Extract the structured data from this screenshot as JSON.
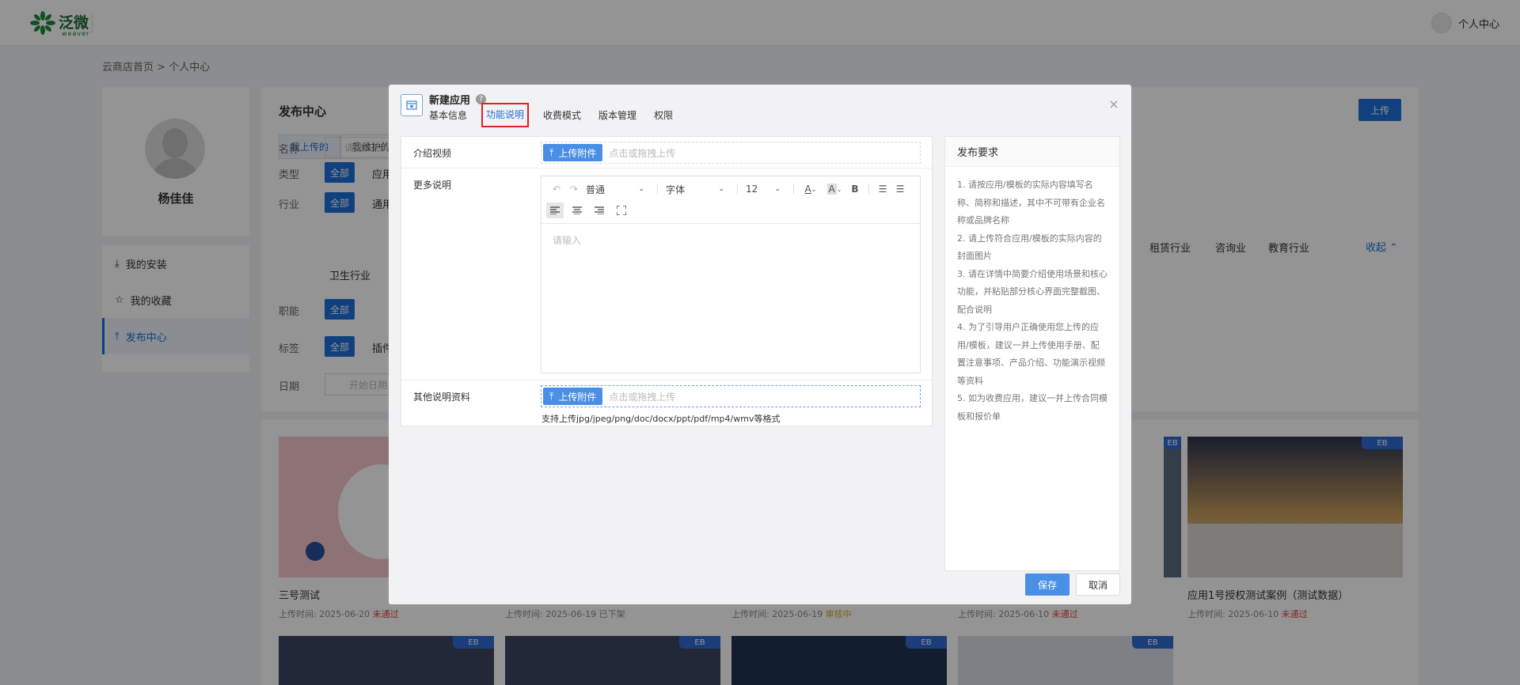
{
  "topbar": {
    "logo_text": "泛微",
    "logo_sub": "weaver",
    "user_label": "个人中心"
  },
  "breadcrumb": {
    "home": "云商店首页",
    "sep": ">",
    "current": "个人中心"
  },
  "profile": {
    "name": "杨佳佳"
  },
  "side_menu": {
    "items": [
      {
        "label": "我的安装"
      },
      {
        "label": "我的收藏"
      },
      {
        "label": "发布中心"
      }
    ]
  },
  "main": {
    "title": "发布中心",
    "upload_label": "上传",
    "tabs": [
      "我上传的",
      "我维护的"
    ],
    "filters": {
      "name_label": "名称",
      "name_placeholder": "请输入应用",
      "type_label": "类型",
      "type_first": "应用",
      "industry_label": "行业",
      "industry_first": "通用",
      "industry_more": [
        "租赁行业",
        "咨询业",
        "教育行业"
      ],
      "industry_row2": "卫生行业",
      "function_label": "职能",
      "tag_label": "标签",
      "tag_first": "插件",
      "date_label": "日期",
      "date_placeholder": "开始日期",
      "all_label": "全部",
      "collapse_label": "收起"
    }
  },
  "cards": [
    {
      "title": "三号测试",
      "date_label": "上传时间:",
      "date": "2025-06-20",
      "status": "未通过"
    },
    {
      "title": "",
      "date_label": "上传时间:",
      "date": "2025-06-19",
      "status": "已下架"
    },
    {
      "title": "",
      "date_label": "上传时间:",
      "date": "2025-06-19",
      "status": "审核中"
    },
    {
      "title": "",
      "date_label": "上传时间:",
      "date": "2025-06-10",
      "status": "未通过"
    },
    {
      "title": "应用1号授权测试案例（测试数据）",
      "date_label": "上传时间:",
      "date": "2025-06-10",
      "status": "未通过"
    }
  ],
  "badge_label": "EB",
  "modal": {
    "title": "新建应用",
    "help": "?",
    "tabs": [
      {
        "label": "基本信息"
      },
      {
        "label": "功能说明"
      },
      {
        "label": "收费模式"
      },
      {
        "label": "版本管理"
      },
      {
        "label": "权限"
      }
    ],
    "close": "×",
    "form": {
      "video_label": "介绍视频",
      "more_label": "更多说明",
      "other_label": "其他说明资料",
      "upload_btn": "上传附件",
      "upload_hint": "点击或拖拽上传",
      "support_text": "支持上传jpg/jpeg/png/doc/docx/ppt/pdf/mp4/wmv等格式",
      "editor": {
        "paragraph": "普通",
        "font": "字体",
        "size": "12",
        "bold": "B",
        "placeholder": "请输入"
      }
    },
    "requirements": {
      "title": "发布要求",
      "items": [
        "1. 请按应用/模板的实际内容填写名称、简称和描述，其中不可带有企业名称或品牌名称",
        "2. 请上传符合应用/模板的实际内容的封面图片",
        "3. 请在详情中简要介绍使用场景和核心功能，并粘贴部分核心界面完整截图、配合说明",
        "4. 为了引导用户正确使用您上传的应用/模板，建议一并上传使用手册、配置注意事项、产品介绍、功能演示视频等资料",
        "5. 如为收费应用，建议一并上传合同模板和报价单"
      ]
    },
    "save_label": "保存",
    "cancel_label": "取消"
  }
}
